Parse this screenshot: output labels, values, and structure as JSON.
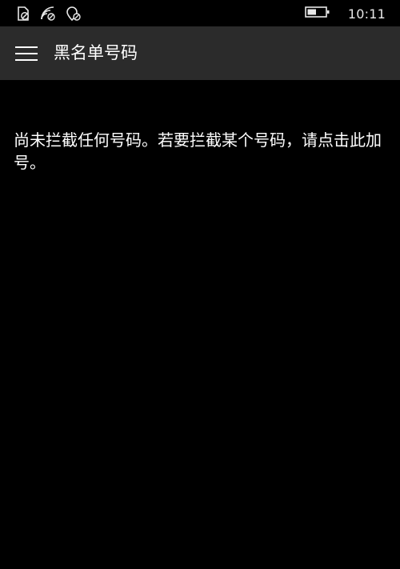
{
  "status_bar": {
    "time": "10:11",
    "icons": [
      "no-sim-icon",
      "wifi-blocked-icon",
      "location-blocked-icon",
      "battery-icon"
    ],
    "battery_level": 0.5
  },
  "header": {
    "menu_icon": "hamburger-icon",
    "title": "黑名单号码",
    "background": "#2b2b2b"
  },
  "main": {
    "empty_message": "尚未拦截任何号码。若要拦截某个号码，请点击此加号。",
    "background": "#000000"
  }
}
